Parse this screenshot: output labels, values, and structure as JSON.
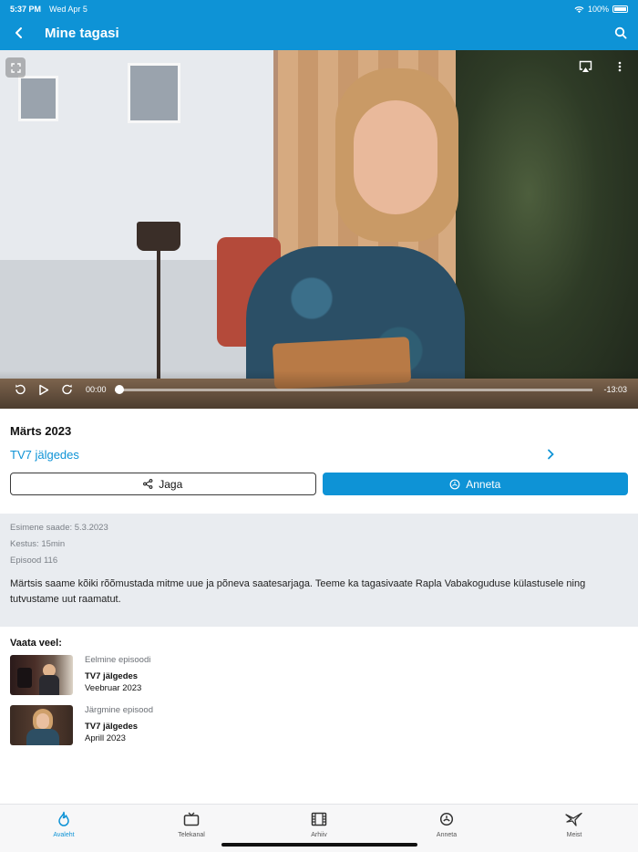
{
  "status_bar": {
    "time": "5:37 PM",
    "date": "Wed Apr 5",
    "battery": "100%"
  },
  "header": {
    "title": "Mine tagasi",
    "back_icon": "chevron-left-icon",
    "search_icon": "search-icon"
  },
  "player": {
    "current_time": "00:00",
    "remaining_time": "-13:03",
    "progress": 0
  },
  "episode": {
    "title": "Märts 2023",
    "series": "TV7 jälgedes",
    "share_label": "Jaga",
    "donate_label": "Anneta"
  },
  "details": {
    "first_aired": "Esimene saade: 5.3.2023",
    "duration": "Kestus: 15min",
    "episode_number": "Episood 116",
    "description": "Märtsis saame kõiki rõõmustada mitme uue ja põneva saatesarjaga. Teeme ka tagasivaate Rapla Vabakoguduse külastusele ning tutvustame uut raamatut."
  },
  "more": {
    "title": "Vaata veel:",
    "items": [
      {
        "kind": "Eelmine episoodi",
        "series": "TV7 jälgedes",
        "month": "Veebruar 2023"
      },
      {
        "kind": "Järgmine episood",
        "series": "TV7 jälgedes",
        "month": "Aprill 2023"
      }
    ]
  },
  "tabs": [
    {
      "label": "Avaleht",
      "icon": "flame-icon",
      "active": true
    },
    {
      "label": "Telekanal",
      "icon": "tv-icon",
      "active": false
    },
    {
      "label": "Arhiiv",
      "icon": "film-icon",
      "active": false
    },
    {
      "label": "Anneta",
      "icon": "donate-icon",
      "active": false
    },
    {
      "label": "Meist",
      "icon": "bird-icon",
      "active": false
    }
  ],
  "colors": {
    "accent": "#0e93d6",
    "details_bg": "#e9ecf0"
  }
}
